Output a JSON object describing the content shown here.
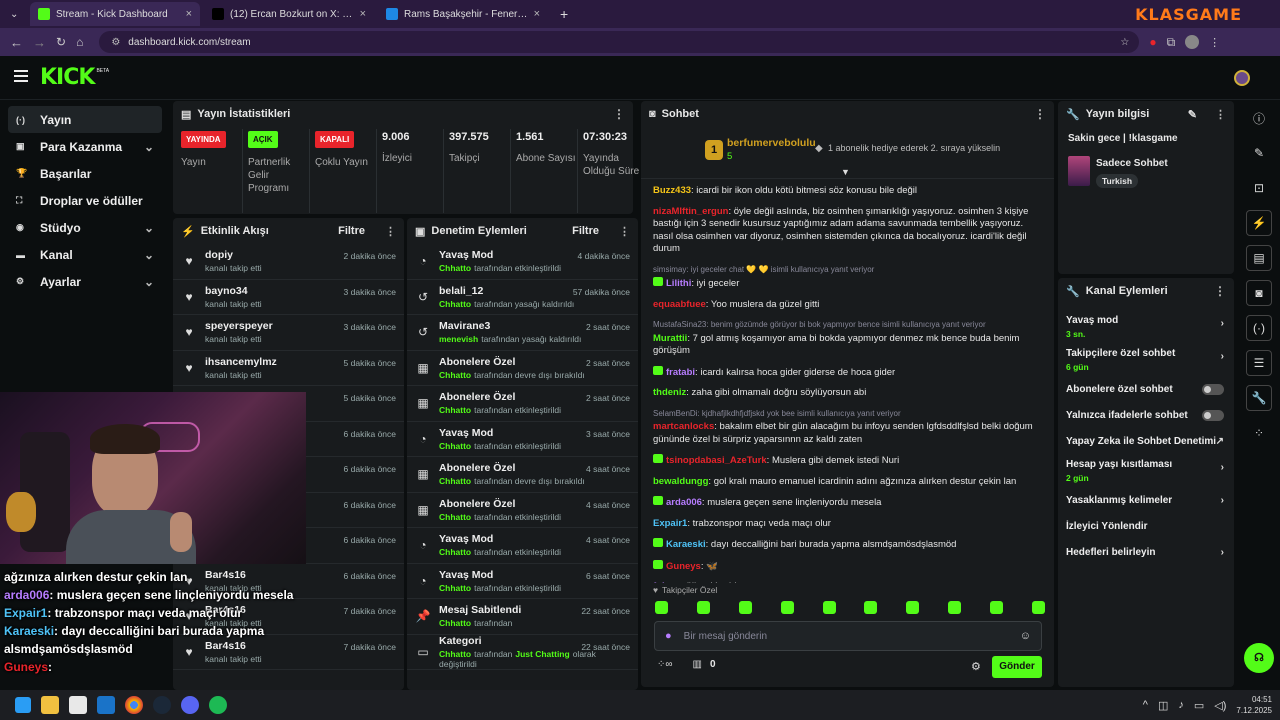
{
  "browser": {
    "tabs": [
      {
        "title": "Stream - Kick Dashboard",
        "favicon_color": "#53fc18"
      },
      {
        "title": "(12) Ercan Bozkurt on X: \". @Ar",
        "favicon_color": "#000000"
      },
      {
        "title": "Rams Başakşehir - Fenerbahçe",
        "favicon_color": "#1e88e5"
      }
    ],
    "url": "dashboard.kick.com/stream",
    "overlay_brand": "KLASGAME"
  },
  "logo": {
    "text": "KICK",
    "sup": "BETA"
  },
  "sidebar": [
    {
      "label": "Yayın",
      "icon": "broadcast-icon",
      "glyph": "(·)",
      "active": true,
      "chev": false
    },
    {
      "label": "Para Kazanma",
      "icon": "money-icon",
      "glyph": "▣",
      "chev": true
    },
    {
      "label": "Başarılar",
      "icon": "trophy-icon",
      "glyph": "🏆",
      "chev": false
    },
    {
      "label": "Droplar ve ödüller",
      "icon": "gift-icon",
      "glyph": "⛶",
      "chev": false
    },
    {
      "label": "Stüdyo",
      "icon": "studio-icon",
      "glyph": "◉",
      "chev": true
    },
    {
      "label": "Kanal",
      "icon": "channel-icon",
      "glyph": "▬",
      "chev": true
    },
    {
      "label": "Ayarlar",
      "icon": "settings-icon",
      "glyph": "⚙",
      "chev": true
    }
  ],
  "stats": {
    "title": "Yayın İstatistikleri",
    "items": [
      {
        "badge": "YAYINDA",
        "badge_color": "#e8242b",
        "label": "Yayın"
      },
      {
        "badge": "AÇIK",
        "badge_color": "#53fc18",
        "label": "Partnerlik Gelir Programı"
      },
      {
        "badge": "KAPALI",
        "badge_color": "#e8242b",
        "label": "Çoklu Yayın"
      },
      {
        "value": "9.006",
        "label": "İzleyici"
      },
      {
        "value": "397.575",
        "label": "Takipçi"
      },
      {
        "value": "1.561",
        "label": "Abone Sayısı"
      },
      {
        "value": "07:30:23",
        "label": "Yayında Olduğu Süre"
      }
    ]
  },
  "activity": {
    "title": "Etkinlik Akışı",
    "filter": "Filtre",
    "rows": [
      {
        "name": "dopiy",
        "sub": "kanalı takip etti",
        "time": "2 dakika önce"
      },
      {
        "name": "bayno34",
        "sub": "kanalı takip etti",
        "time": "3 dakika önce"
      },
      {
        "name": "speyerspeyer",
        "sub": "kanalı takip etti",
        "time": "3 dakika önce"
      },
      {
        "name": "ihsancemylmz",
        "sub": "kanalı takip etti",
        "time": "5 dakika önce"
      },
      {
        "name": "",
        "sub": "",
        "time": "5 dakika önce"
      },
      {
        "name": "",
        "sub": "",
        "time": "6 dakika önce"
      },
      {
        "name": "",
        "sub": "",
        "time": "6 dakika önce"
      },
      {
        "name": "",
        "sub": "",
        "time": "6 dakika önce"
      },
      {
        "name": "",
        "sub": "",
        "time": "6 dakika önce"
      },
      {
        "name": "Bar4s16",
        "sub": "kanalı takip etti",
        "time": "6 dakika önce"
      },
      {
        "name": "Bar4s16",
        "sub": "kanalı takip etti",
        "time": "7 dakika önce"
      },
      {
        "name": "Bar4s16",
        "sub": "kanalı takip etti",
        "time": "7 dakika önce"
      }
    ]
  },
  "moderation": {
    "title": "Denetim Eylemleri",
    "filter": "Filtre",
    "rows": [
      {
        "name": "Yavaş Mod",
        "by": "Chhatto",
        "sub": "tarafından etkinleştirildi",
        "time": "4 dakika önce",
        "icon": "slow-mode-icon",
        "glyph": "◔"
      },
      {
        "name": "belali_12",
        "by": "Chhatto",
        "sub": "tarafından yasağı kaldırıldı",
        "time": "57 dakika önce",
        "icon": "unban-icon",
        "glyph": "↺"
      },
      {
        "name": "Mavirane3",
        "by": "menevish",
        "sub": "tarafından yasağı kaldırıldı",
        "time": "2 saat önce",
        "icon": "unban-icon",
        "glyph": "↺"
      },
      {
        "name": "Abonelere Özel",
        "by": "Chhatto",
        "sub": "tarafından devre dışı bırakıldı",
        "time": "2 saat önce",
        "icon": "gift-icon",
        "glyph": "▦"
      },
      {
        "name": "Abonelere Özel",
        "by": "Chhatto",
        "sub": "tarafından etkinleştirildi",
        "time": "2 saat önce",
        "icon": "gift-icon",
        "glyph": "▦"
      },
      {
        "name": "Yavaş Mod",
        "by": "Chhatto",
        "sub": "tarafından etkinleştirildi",
        "time": "3 saat önce",
        "icon": "slow-mode-icon",
        "glyph": "◔"
      },
      {
        "name": "Abonelere Özel",
        "by": "Chhatto",
        "sub": "tarafından devre dışı bırakıldı",
        "time": "4 saat önce",
        "icon": "gift-icon",
        "glyph": "▦"
      },
      {
        "name": "Abonelere Özel",
        "by": "Chhatto",
        "sub": "tarafından etkinleştirildi",
        "time": "4 saat önce",
        "icon": "gift-icon",
        "glyph": "▦"
      },
      {
        "name": "Yavaş Mod",
        "by": "Chhatto",
        "sub": "tarafından etkinleştirildi",
        "time": "4 saat önce",
        "icon": "slow-mode-icon",
        "glyph": "◔"
      },
      {
        "name": "Yavaş Mod",
        "by": "Chhatto",
        "sub": "tarafından etkinleştirildi",
        "time": "6 saat önce",
        "icon": "slow-mode-icon",
        "glyph": "◔"
      },
      {
        "name": "Mesaj Sabitlendi",
        "by": "Chhatto",
        "sub": "tarafından",
        "time": "22 saat önce",
        "icon": "pin-icon",
        "glyph": "📌"
      },
      {
        "name": "Kategori",
        "by": "Chhatto",
        "sub": "tarafından",
        "extra": "Just Chatting",
        "extra2": "olarak değiştirildi",
        "time": "22 saat önce",
        "icon": "category-icon",
        "glyph": "▭"
      }
    ]
  },
  "chat": {
    "title": "Sohbet",
    "pinned": {
      "user": "berfumervebolulu",
      "count": "5",
      "rank": "1",
      "text": "1 abonelik hediye ederek 2. sıraya yükselin"
    },
    "messages": [
      {
        "user": "Buzz433",
        "color": "#f5c518",
        "text": "icardi bir ikon oldu kötü bitmesi söz konusu bile değil"
      },
      {
        "user": "nizaMIftin_ergun",
        "color": "#e8242b",
        "text": "öyle değil aslında, biz osimhen şımarıklığı yaşıyoruz. osimhen 3 kişiye bastığı için 3 senedir kusursuz yaptığımız adam adama savunmada tembellik yaşıyoruz. nasıl olsa osimhen var diyoruz, osimhen sistemden çıkınca da bocalıyoruz. icardi'lik değil durum"
      },
      {
        "reply": "simsimay: iyi geceler chat  💛 💛  isimli kullanıcıya yanıt veriyor",
        "user": "Lilithi",
        "color": "#b77dff",
        "text": "iyi geceler",
        "badge": true
      },
      {
        "user": "equaabfuee",
        "color": "#e8242b",
        "text": "Yoo muslera da güzel gitti"
      },
      {
        "reply": "MustafaSina23: benim gözümde görüyor bi bok yapmıyor bence isimli kullanıcıya yanıt veriyor",
        "user": "Murattii",
        "color": "#53fc18",
        "text": "7 gol atmış koşamıyor ama bi bokda yapmıyor denmez mk bence buda benim görüşüm"
      },
      {
        "user": "fratabi",
        "color": "#b77dff",
        "text": "icardı kalırsa hoca gider giderse de hoca gider",
        "badge": true
      },
      {
        "user": "thdeniz",
        "color": "#53fc18",
        "text": "zaha gibi olmamalı doğru söylüyorsun abi"
      },
      {
        "reply": "SelamBenDi: kjdhafjlkdhfjdfjskd yok bee isimli kullanıcıya yanıt veriyor",
        "user": "martcanlocks",
        "color": "#e8242b",
        "text": "bakalım elbet bir gün alacağım bu infoyu senden lgfdsddlfşlsd belki doğum gününde özel bi sürpriz yaparsınnn az kaldı zaten"
      },
      {
        "user": "tsinopdabasi_AzeTurk",
        "color": "#e8242b",
        "text": "Muslera gibi demek istedi Nuri",
        "badge": true
      },
      {
        "user": "bewaldungg",
        "color": "#53fc18",
        "text": "gol kralı mauro emanuel icardinin adını ağzınıza alırken destur çekin lan"
      },
      {
        "user": "arda006",
        "color": "#b77dff",
        "text": "muslera geçen sene linçleniyordu mesela",
        "badge": true
      },
      {
        "user": "Expair1",
        "color": "#4fc3f7",
        "text": "trabzonspor maçı veda maçı olur"
      },
      {
        "user": "Karaeski",
        "color": "#4fc3f7",
        "text": "dayı deccalliğini bari burada yapma alsmdşamösdşlasmöd",
        "badge": true
      },
      {
        "user": "Guneys",
        "color": "#e8242b",
        "text": "🦋",
        "badge": true
      },
      {
        "user": "fukraz",
        "color": "#b77dff",
        "text": "öğretti harbi"
      }
    ],
    "followers_only_label": "Takipçiler Özel",
    "input_placeholder": "Bir mesaj gönderin",
    "points": "0",
    "send": "Gönder"
  },
  "info": {
    "title": "Yayın bilgisi",
    "stream_title": "Sakin gece | !klasgame",
    "category": "Sadece Sohbet",
    "tag": "Turkish"
  },
  "actions": {
    "title": "Kanal Eylemleri",
    "items": [
      {
        "label": "Yavaş mod",
        "sub": "3 sn.",
        "kind": "chev"
      },
      {
        "label": "Takipçilere özel sohbet",
        "sub": "6 gün",
        "kind": "chev"
      },
      {
        "label": "Abonelere özel sohbet",
        "kind": "toggle"
      },
      {
        "label": "Yalnızca ifadelerle sohbet",
        "kind": "toggle"
      },
      {
        "label": "Yapay Zeka ile Sohbet Denetimi",
        "kind": "ext"
      },
      {
        "label": "Hesap yaşı kısıtlaması",
        "sub": "2 gün",
        "kind": "chev"
      },
      {
        "label": "Yasaklanmış kelimeler",
        "kind": "chev"
      },
      {
        "label": "İzleyici Yönlendir",
        "kind": "none"
      },
      {
        "label": "Hedefleri belirleyin",
        "kind": "chev"
      }
    ]
  },
  "overlay_chat": [
    {
      "user": "",
      "text": "ağzınıza alırken destur çekin lan",
      "color": "#ffffff"
    },
    {
      "user": "arda006",
      "text": ": muslera geçen sene linçleniyordu mesela",
      "color": "#b77dff"
    },
    {
      "user": "Expair1",
      "text": ": trabzonspor maçı veda maçı olur",
      "color": "#4fc3f7"
    },
    {
      "user": "Karaeski",
      "text": ": dayı deccalliğini bari burada yapma",
      "color": "#4fc3f7"
    },
    {
      "user": "",
      "text": "alsmdşamösdşlasmöd",
      "color": "#ffffff"
    },
    {
      "user": "Guneys",
      "text": ":",
      "color": "#e8242b"
    }
  ],
  "taskbar": {
    "time": "04:51",
    "date": "7.12.2025"
  }
}
